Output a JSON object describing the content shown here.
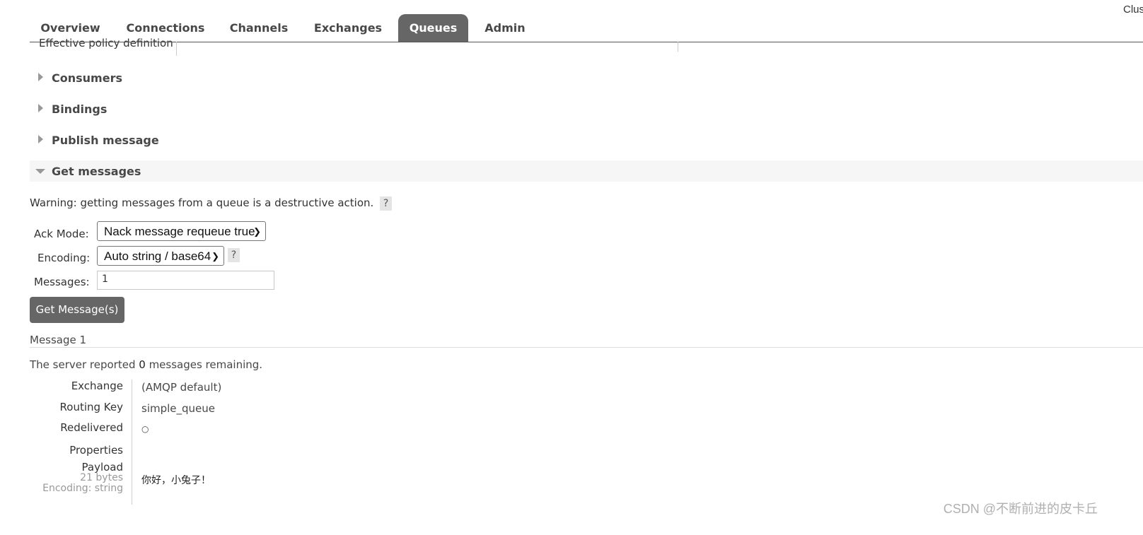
{
  "header": {
    "cluster_label": "Clus"
  },
  "nav": {
    "tabs": [
      {
        "label": "Overview"
      },
      {
        "label": "Connections"
      },
      {
        "label": "Channels"
      },
      {
        "label": "Exchanges"
      },
      {
        "label": "Queues",
        "active": true
      },
      {
        "label": "Admin"
      }
    ]
  },
  "policy": {
    "label": "Effective policy definition"
  },
  "sections": {
    "consumers": "Consumers",
    "bindings": "Bindings",
    "publish": "Publish message",
    "get": "Get messages"
  },
  "get_messages": {
    "warning": "Warning: getting messages from a queue is a destructive action.",
    "help": "?",
    "ack_mode_label": "Ack Mode:",
    "ack_mode_value": "Nack message requeue true",
    "encoding_label": "Encoding:",
    "encoding_value": "Auto string / base64",
    "messages_label": "Messages:",
    "messages_value": "1",
    "button": "Get Message(s)"
  },
  "result": {
    "title": "Message 1",
    "remaining_prefix": "The server reported ",
    "remaining_count": "0",
    "remaining_suffix": " messages remaining.",
    "fields": {
      "exchange_key": "Exchange",
      "exchange_value": "(AMQP default)",
      "routing_key_key": "Routing Key",
      "routing_key_value": "simple_queue",
      "redelivered_key": "Redelivered",
      "redelivered_value": "○",
      "properties_key": "Properties",
      "payload_key": "Payload",
      "payload_size": "21 bytes",
      "payload_encoding": "Encoding: string",
      "payload_value": "你好，小兔子！"
    }
  },
  "watermark": "CSDN @不断前进的皮卡丘",
  "colors": {
    "tab_active_bg": "#666666",
    "button_bg": "#666666",
    "section_open_bg": "#f6f6f6"
  }
}
